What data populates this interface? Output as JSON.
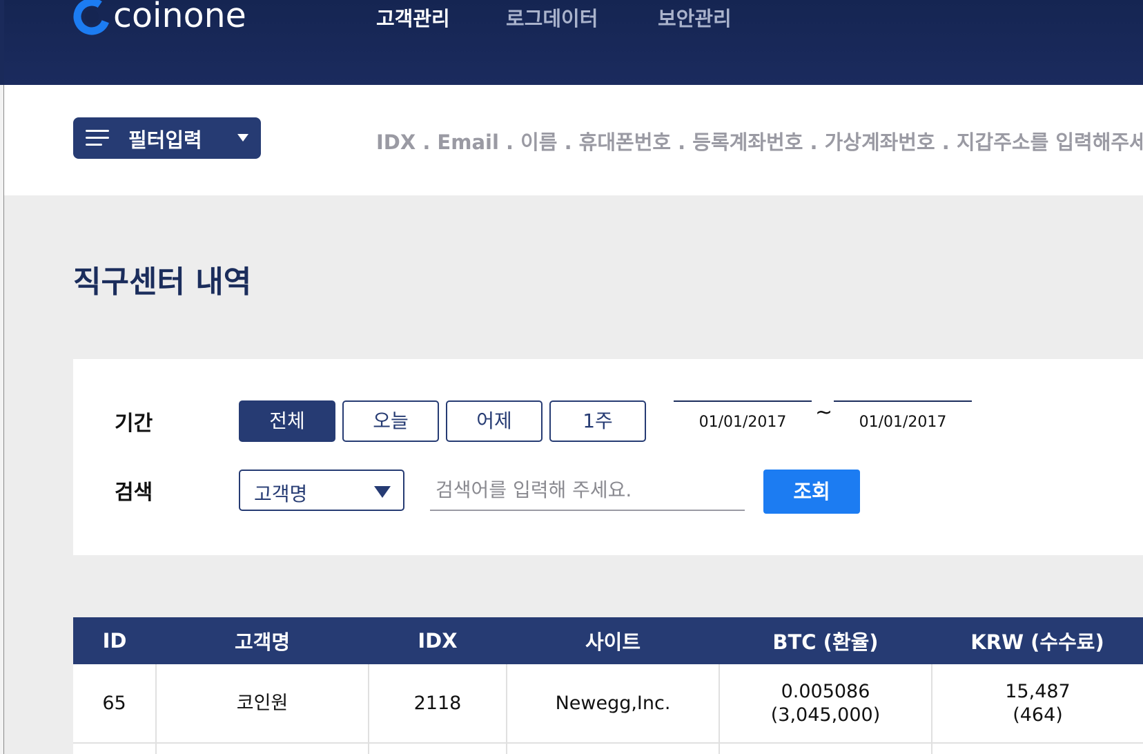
{
  "app": {
    "logo_text": "coinone",
    "brand_color": "#263b73",
    "accent_color": "#1c7cf2"
  },
  "nav": {
    "items": [
      {
        "label": "고객관리",
        "active": true
      },
      {
        "label": "로그데이터",
        "active": false
      },
      {
        "label": "보안관리",
        "active": false
      }
    ]
  },
  "filter": {
    "button_label": "필터입력",
    "menu_icon": "hamburger-icon",
    "caret_icon": "caret-down-icon",
    "hint": "IDX . Email . 이름 . 휴대폰번호 . 등록계좌번호 . 가상계좌번호 . 지갑주소를 입력해주세요."
  },
  "page": {
    "title": "직구센터 내역"
  },
  "search": {
    "period_label": "기간",
    "period_buttons": [
      {
        "label": "전체",
        "active": true
      },
      {
        "label": "오늘",
        "active": false
      },
      {
        "label": "어제",
        "active": false
      },
      {
        "label": "1주",
        "active": false
      }
    ],
    "date_from": "01/01/2017",
    "date_separator": "~",
    "date_to": "01/01/2017",
    "search_label": "검색",
    "select_value": "고객명",
    "input_value": "",
    "input_placeholder": "검색어를 입력해 주세요.",
    "submit_label": "조회"
  },
  "table": {
    "columns": [
      "ID",
      "고객명",
      "IDX",
      "사이트",
      "BTC (환율)",
      "KRW (수수료)"
    ],
    "rows": [
      {
        "id": "65",
        "customer": "코인원",
        "idx": "2118",
        "site": "Newegg,Inc.",
        "btc": "0.005086",
        "btc_rate": "(3,045,000)",
        "krw": "15,487",
        "krw_fee": "(464)"
      }
    ]
  }
}
